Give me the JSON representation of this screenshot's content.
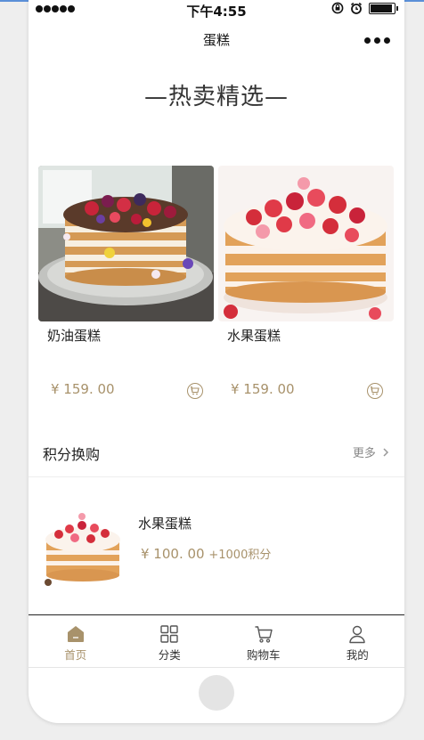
{
  "status": {
    "time": "下午4:55"
  },
  "nav": {
    "title": "蛋糕"
  },
  "section": {
    "title": "—热卖精选—"
  },
  "products": [
    {
      "name": "奶油蛋糕",
      "price": "¥ 159. 00"
    },
    {
      "name": "水果蛋糕",
      "price": "¥ 159. 00"
    }
  ],
  "points": {
    "title": "积分换购",
    "more_label": "更多",
    "item": {
      "name": "水果蛋糕",
      "price": "¥ 100. 00",
      "points": "+1000积分"
    }
  },
  "tabs": [
    {
      "label": "首页"
    },
    {
      "label": "分类"
    },
    {
      "label": "购物车"
    },
    {
      "label": "我的"
    }
  ],
  "colors": {
    "accent": "#a8926b",
    "topline": "#5b8fd8"
  }
}
